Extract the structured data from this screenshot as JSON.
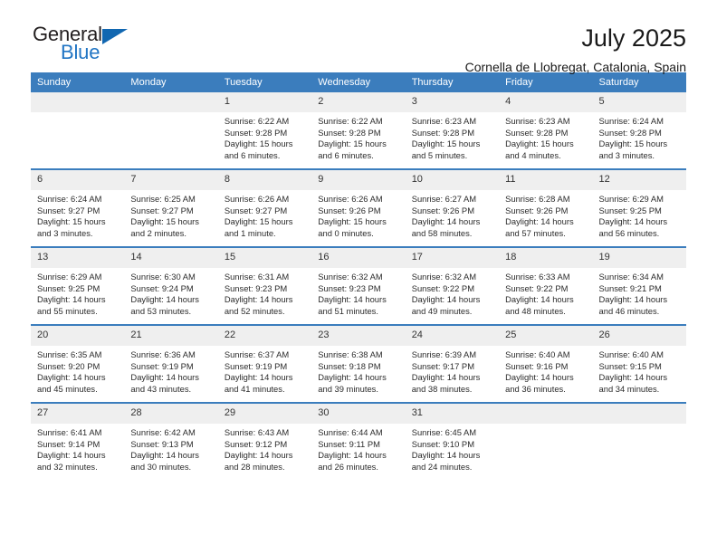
{
  "brand": {
    "name_part1": "General",
    "name_part2": "Blue",
    "triangle_color": "#1167b1",
    "blue_color": "#2175c4"
  },
  "header": {
    "title": "July 2025",
    "subtitle": "Cornella de Llobregat, Catalonia, Spain"
  },
  "theme": {
    "header_bg": "#3b7dbd",
    "daynum_bg": "#efefef",
    "cell_bg": "#ffffff",
    "text": "#2b2b2b"
  },
  "weekdays": [
    "Sunday",
    "Monday",
    "Tuesday",
    "Wednesday",
    "Thursday",
    "Friday",
    "Saturday"
  ],
  "labels": {
    "sunrise_prefix": "Sunrise:",
    "sunset_prefix": "Sunset:",
    "daylight_prefix": "Daylight:"
  },
  "weeks": [
    [
      {
        "day": "",
        "sunrise": "",
        "sunset": "",
        "daylight": "",
        "blank": true
      },
      {
        "day": "",
        "sunrise": "",
        "sunset": "",
        "daylight": "",
        "blank": true
      },
      {
        "day": "1",
        "sunrise": "Sunrise: 6:22 AM",
        "sunset": "Sunset: 9:28 PM",
        "daylight": "Daylight: 15 hours and 6 minutes."
      },
      {
        "day": "2",
        "sunrise": "Sunrise: 6:22 AM",
        "sunset": "Sunset: 9:28 PM",
        "daylight": "Daylight: 15 hours and 6 minutes."
      },
      {
        "day": "3",
        "sunrise": "Sunrise: 6:23 AM",
        "sunset": "Sunset: 9:28 PM",
        "daylight": "Daylight: 15 hours and 5 minutes."
      },
      {
        "day": "4",
        "sunrise": "Sunrise: 6:23 AM",
        "sunset": "Sunset: 9:28 PM",
        "daylight": "Daylight: 15 hours and 4 minutes."
      },
      {
        "day": "5",
        "sunrise": "Sunrise: 6:24 AM",
        "sunset": "Sunset: 9:28 PM",
        "daylight": "Daylight: 15 hours and 3 minutes."
      }
    ],
    [
      {
        "day": "6",
        "sunrise": "Sunrise: 6:24 AM",
        "sunset": "Sunset: 9:27 PM",
        "daylight": "Daylight: 15 hours and 3 minutes."
      },
      {
        "day": "7",
        "sunrise": "Sunrise: 6:25 AM",
        "sunset": "Sunset: 9:27 PM",
        "daylight": "Daylight: 15 hours and 2 minutes."
      },
      {
        "day": "8",
        "sunrise": "Sunrise: 6:26 AM",
        "sunset": "Sunset: 9:27 PM",
        "daylight": "Daylight: 15 hours and 1 minute."
      },
      {
        "day": "9",
        "sunrise": "Sunrise: 6:26 AM",
        "sunset": "Sunset: 9:26 PM",
        "daylight": "Daylight: 15 hours and 0 minutes."
      },
      {
        "day": "10",
        "sunrise": "Sunrise: 6:27 AM",
        "sunset": "Sunset: 9:26 PM",
        "daylight": "Daylight: 14 hours and 58 minutes."
      },
      {
        "day": "11",
        "sunrise": "Sunrise: 6:28 AM",
        "sunset": "Sunset: 9:26 PM",
        "daylight": "Daylight: 14 hours and 57 minutes."
      },
      {
        "day": "12",
        "sunrise": "Sunrise: 6:29 AM",
        "sunset": "Sunset: 9:25 PM",
        "daylight": "Daylight: 14 hours and 56 minutes."
      }
    ],
    [
      {
        "day": "13",
        "sunrise": "Sunrise: 6:29 AM",
        "sunset": "Sunset: 9:25 PM",
        "daylight": "Daylight: 14 hours and 55 minutes."
      },
      {
        "day": "14",
        "sunrise": "Sunrise: 6:30 AM",
        "sunset": "Sunset: 9:24 PM",
        "daylight": "Daylight: 14 hours and 53 minutes."
      },
      {
        "day": "15",
        "sunrise": "Sunrise: 6:31 AM",
        "sunset": "Sunset: 9:23 PM",
        "daylight": "Daylight: 14 hours and 52 minutes."
      },
      {
        "day": "16",
        "sunrise": "Sunrise: 6:32 AM",
        "sunset": "Sunset: 9:23 PM",
        "daylight": "Daylight: 14 hours and 51 minutes."
      },
      {
        "day": "17",
        "sunrise": "Sunrise: 6:32 AM",
        "sunset": "Sunset: 9:22 PM",
        "daylight": "Daylight: 14 hours and 49 minutes."
      },
      {
        "day": "18",
        "sunrise": "Sunrise: 6:33 AM",
        "sunset": "Sunset: 9:22 PM",
        "daylight": "Daylight: 14 hours and 48 minutes."
      },
      {
        "day": "19",
        "sunrise": "Sunrise: 6:34 AM",
        "sunset": "Sunset: 9:21 PM",
        "daylight": "Daylight: 14 hours and 46 minutes."
      }
    ],
    [
      {
        "day": "20",
        "sunrise": "Sunrise: 6:35 AM",
        "sunset": "Sunset: 9:20 PM",
        "daylight": "Daylight: 14 hours and 45 minutes."
      },
      {
        "day": "21",
        "sunrise": "Sunrise: 6:36 AM",
        "sunset": "Sunset: 9:19 PM",
        "daylight": "Daylight: 14 hours and 43 minutes."
      },
      {
        "day": "22",
        "sunrise": "Sunrise: 6:37 AM",
        "sunset": "Sunset: 9:19 PM",
        "daylight": "Daylight: 14 hours and 41 minutes."
      },
      {
        "day": "23",
        "sunrise": "Sunrise: 6:38 AM",
        "sunset": "Sunset: 9:18 PM",
        "daylight": "Daylight: 14 hours and 39 minutes."
      },
      {
        "day": "24",
        "sunrise": "Sunrise: 6:39 AM",
        "sunset": "Sunset: 9:17 PM",
        "daylight": "Daylight: 14 hours and 38 minutes."
      },
      {
        "day": "25",
        "sunrise": "Sunrise: 6:40 AM",
        "sunset": "Sunset: 9:16 PM",
        "daylight": "Daylight: 14 hours and 36 minutes."
      },
      {
        "day": "26",
        "sunrise": "Sunrise: 6:40 AM",
        "sunset": "Sunset: 9:15 PM",
        "daylight": "Daylight: 14 hours and 34 minutes."
      }
    ],
    [
      {
        "day": "27",
        "sunrise": "Sunrise: 6:41 AM",
        "sunset": "Sunset: 9:14 PM",
        "daylight": "Daylight: 14 hours and 32 minutes."
      },
      {
        "day": "28",
        "sunrise": "Sunrise: 6:42 AM",
        "sunset": "Sunset: 9:13 PM",
        "daylight": "Daylight: 14 hours and 30 minutes."
      },
      {
        "day": "29",
        "sunrise": "Sunrise: 6:43 AM",
        "sunset": "Sunset: 9:12 PM",
        "daylight": "Daylight: 14 hours and 28 minutes."
      },
      {
        "day": "30",
        "sunrise": "Sunrise: 6:44 AM",
        "sunset": "Sunset: 9:11 PM",
        "daylight": "Daylight: 14 hours and 26 minutes."
      },
      {
        "day": "31",
        "sunrise": "Sunrise: 6:45 AM",
        "sunset": "Sunset: 9:10 PM",
        "daylight": "Daylight: 14 hours and 24 minutes."
      },
      {
        "day": "",
        "sunrise": "",
        "sunset": "",
        "daylight": "",
        "blank": true
      },
      {
        "day": "",
        "sunrise": "",
        "sunset": "",
        "daylight": "",
        "blank": true
      }
    ]
  ]
}
